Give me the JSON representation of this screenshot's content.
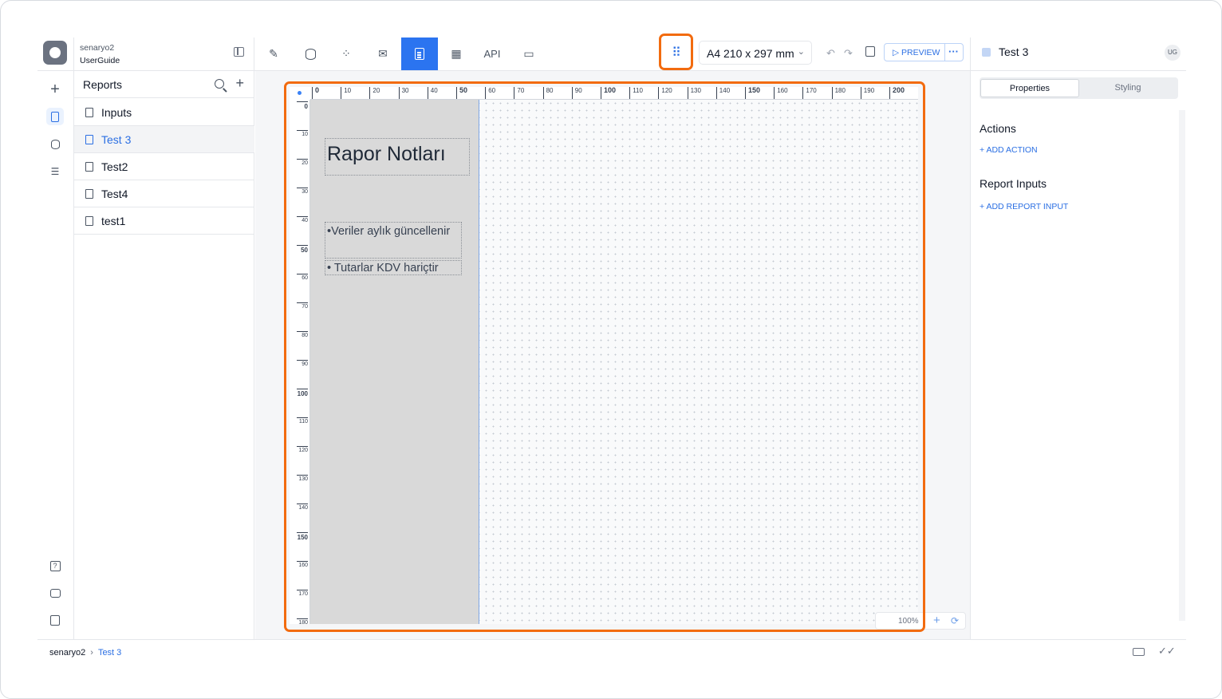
{
  "workspace": {
    "name": "senaryo2",
    "project": "UserGuide"
  },
  "sidebar": {
    "title": "Reports",
    "items": [
      {
        "label": "Inputs",
        "selected": false
      },
      {
        "label": "Test 3",
        "selected": true
      },
      {
        "label": "Test2",
        "selected": false
      },
      {
        "label": "Test4",
        "selected": false
      },
      {
        "label": "test1",
        "selected": false
      }
    ]
  },
  "toolbar": {
    "api_label": "API",
    "paper_size": "A4 210 x 297 mm",
    "preview_label": "PREVIEW",
    "more_label": "···"
  },
  "ruler": {
    "top": [
      "0",
      "10",
      "20",
      "30",
      "40",
      "50",
      "60",
      "70",
      "80",
      "90",
      "100",
      "110",
      "120",
      "130",
      "140",
      "150",
      "160",
      "170",
      "180",
      "190",
      "200"
    ],
    "left": [
      "0",
      "10",
      "20",
      "30",
      "40",
      "50",
      "60",
      "70",
      "80",
      "90",
      "100",
      "110",
      "120",
      "130",
      "140",
      "150",
      "160",
      "170",
      "180"
    ]
  },
  "canvas": {
    "title": "Rapor Notları",
    "note1": "•Veriler aylık güncellenir",
    "note2": "• Tutarlar KDV hariçtir",
    "zoom": "100%"
  },
  "right_panel": {
    "report_name": "Test 3",
    "user_initials": "UG",
    "tabs": [
      "Properties",
      "Styling"
    ],
    "actions_title": "Actions",
    "add_action": "+ ADD ACTION",
    "inputs_title": "Report Inputs",
    "add_input": "+ ADD REPORT INPUT"
  },
  "breadcrumb": {
    "root": "senaryo2",
    "current": "Test 3"
  },
  "colors": {
    "accent": "#2b74f0",
    "highlight": "#f26b0f"
  }
}
